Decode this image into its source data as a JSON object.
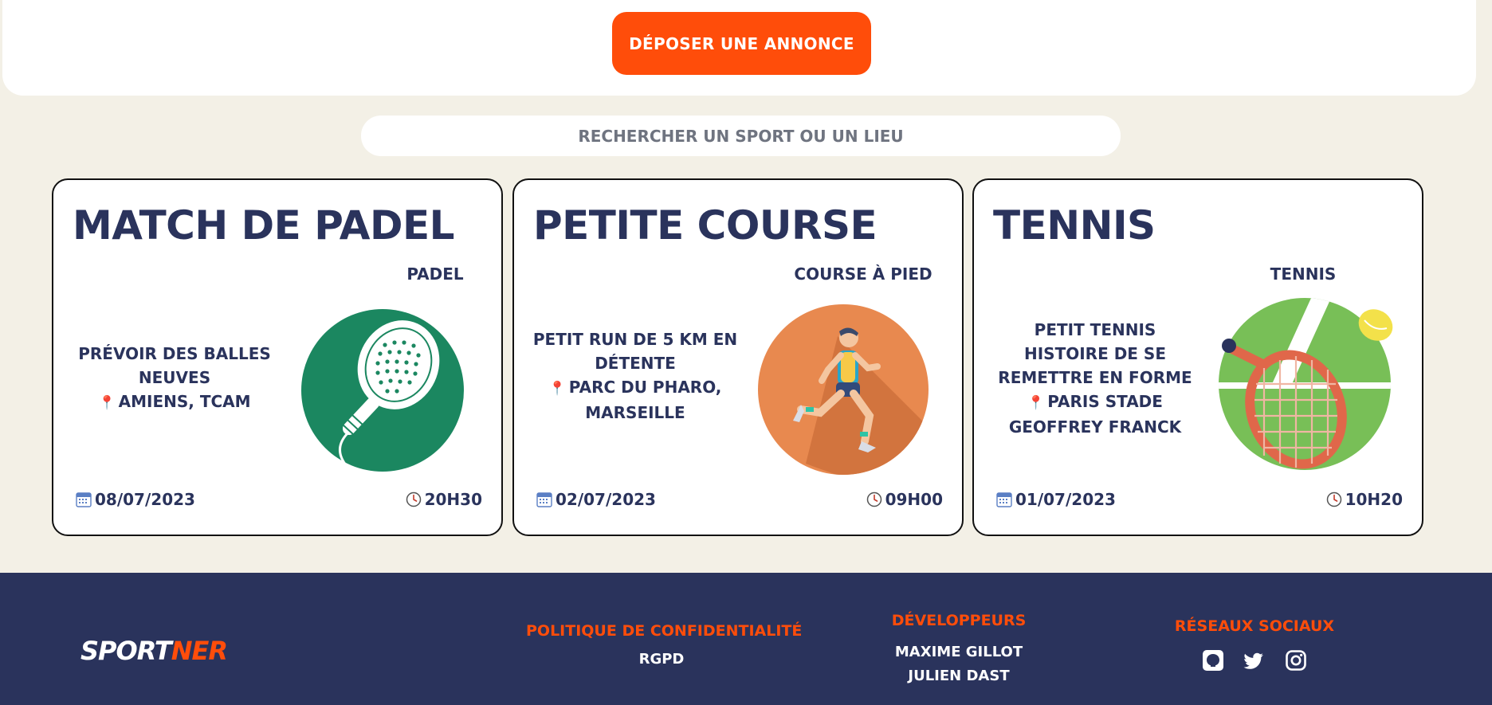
{
  "header": {
    "post_button": "DÉPOSER UNE ANNONCE"
  },
  "search": {
    "placeholder": "RECHERCHER UN SPORT OU UN LIEU"
  },
  "cards": [
    {
      "title": "MATCH DE PADEL",
      "sport": "PADEL",
      "description": "PRÉVOIR DES BALLES NEUVES",
      "location": "AMIENS, TCAM",
      "date": "08/07/2023",
      "time": "20H30",
      "image": "padel-racket-icon"
    },
    {
      "title": "PETITE COURSE",
      "sport": "COURSE À PIED",
      "description": "PETIT RUN DE 5 KM EN DÉTENTE",
      "location": "PARC DU PHARO, MARSEILLE",
      "date": "02/07/2023",
      "time": "09H00",
      "image": "runner-icon"
    },
    {
      "title": "TENNIS",
      "sport": "TENNIS",
      "description": "PETIT TENNIS HISTOIRE DE SE REMETTRE EN FORME",
      "location": "PARIS STADE GEOFFREY FRANCK",
      "date": "01/07/2023",
      "time": "10H20",
      "image": "tennis-racket-icon"
    }
  ],
  "footer": {
    "logo_part1": "SPORT",
    "logo_part2": "NER",
    "privacy_heading": "POLITIQUE DE CONFIDENTIALITÉ",
    "privacy_link": "RGPD",
    "devs_heading": "DÉVELOPPEURS",
    "devs": [
      "MAXIME GILLOT",
      "JULIEN DAST"
    ],
    "social_heading": "RÉSEAUX SOCIAUX",
    "social_icons": [
      "github-icon",
      "twitter-icon",
      "instagram-icon"
    ]
  },
  "colors": {
    "accent": "#ff4d0a",
    "navy": "#2a335c",
    "background": "#f3f0e6",
    "pin": "#e0167a"
  }
}
